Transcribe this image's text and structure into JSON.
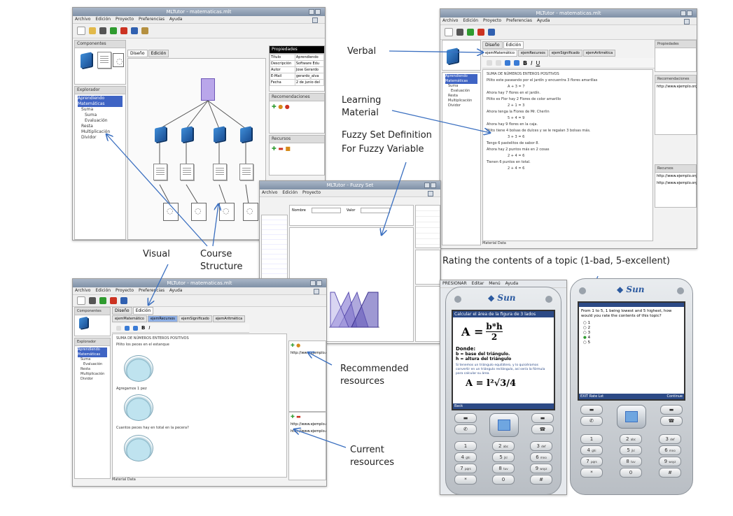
{
  "annotations": {
    "verbal": "Verbal",
    "learning_material": [
      "Learning",
      "Material"
    ],
    "fuzzy_set": [
      "Fuzzy Set Definition",
      "For  Fuzzy Variable"
    ],
    "visual": "Visual",
    "course_structure": [
      "Course",
      "Structure"
    ],
    "rating": "Rating the contents of  a topic (1-bad, 5-excellent)",
    "recommended": [
      "Recommended",
      "resources"
    ],
    "current": [
      "Current",
      "resources"
    ]
  },
  "main_window": {
    "title": "MLTutor - matematicas.mlt",
    "menu": [
      "Archivo",
      "Edición",
      "Proyecto",
      "Preferencias",
      "Ayuda"
    ],
    "components_label": "Componentes",
    "explorer_label": "Explorador",
    "tree": [
      "Aprendiendo Matemáticas",
      "Suma",
      "Suma",
      "Evaluación",
      "Resta",
      "Multiplicación",
      "Dividor"
    ],
    "tabs": [
      "Diseño",
      "Edición"
    ],
    "properties_label": "Propiedades",
    "properties": [
      [
        "Título",
        "Aprendiendo"
      ],
      [
        "Descripción",
        "Software Edu"
      ],
      [
        "Autor",
        "Jose Gerardo"
      ],
      [
        "E-Mail",
        "gerardo_alva"
      ],
      [
        "Fecha",
        "2 de junio del"
      ]
    ],
    "recommendations_label": "Recomendaciones",
    "resources_label": "Recursos"
  },
  "verbal_window": {
    "title": "MLTutor - matematicas.mlt",
    "menu": [
      "Archivo",
      "Edición",
      "Proyecto",
      "Preferencias",
      "Ayuda"
    ],
    "tabs": [
      "Diseño",
      "Edición"
    ],
    "subtabs": [
      "ejemMatemático",
      "ejemRecursos",
      "ejemSignificado",
      "ejemAritmética"
    ],
    "text_lines": [
      "SUMA DE NÚMEROS ENTEROS POSITIVOS",
      "Pilito este paseando por el jardín y encuentra 3 flores amarillas",
      "A + 3 = 7",
      "Ahora hay 7 flores en el jardín.",
      "Pilito es Flor hay 2 Flores de color amarillo",
      "2 + 1 = 3",
      "Ahora tenga la Flores de Mr. Cherlin",
      "5 + 4 = 9",
      "Ahora hay 9 flores en la caja.",
      "Pilito tiene 4 bolsas de dulces y se le regalan 3 bolsas más.",
      "3 + 3 = 6",
      "Tengo 6 pastelitos de sabor 8.",
      "Ahora hay 2 puntos más en 2 cosas",
      "2 + 4 = 6",
      "Tienen 6 puntos en total.",
      "2 + 4 = 6"
    ],
    "status": "Material Data",
    "right_panels": [
      "Propiedades",
      "Recomendaciones",
      "Recursos"
    ],
    "resources": [
      "http://www.ejemplo.org/archivo",
      "http://www.ejemplo.org/ayuda"
    ]
  },
  "fuzzy_window": {
    "title": "MLTutor - Fuzzy Set",
    "inputs": [
      "Nombre",
      "Valor"
    ]
  },
  "visual_window": {
    "title": "MLTutor - matematicas.mlt",
    "menu": [
      "Archivo",
      "Edición",
      "Proyecto",
      "Preferencias",
      "Ayuda"
    ],
    "components_label": "Componentes",
    "explorer_label": "Explorador",
    "tree": [
      "Aprendiendo Matemáticas",
      "Suma",
      "Evaluación",
      "Resta",
      "Multiplicación",
      "Dividor"
    ],
    "tabs": [
      "Diseño",
      "Edición"
    ],
    "subtabs": [
      "ejemMatemático",
      "ejemRecursos",
      "ejemSignificado",
      "ejemAritmética"
    ],
    "text_lines": [
      "SUMA DE NÚMEROS ENTEROS POSITIVOS",
      "Pilito los peces en el estanque",
      "Agregamos 1 pez",
      "Cuantos peces hay en total en la pecera?"
    ],
    "status": "Material Data",
    "resources": [
      "http://www.ejemplo.org/archivo",
      "http://www.ejemplo.org/ayuda"
    ]
  },
  "phone_left": {
    "brand": "Sun",
    "menu": [
      "PRESIONAR",
      "Editar",
      "Menú",
      "Ayuda"
    ],
    "screen_title": "Calcular el área de la figura de 3 lados",
    "formula_1_lhs": "A =",
    "formula_1_num": "b*h",
    "formula_1_den": "2",
    "donde": "Donde:",
    "line_b": "b = base del triángulo.",
    "line_h": "h = altura del triángulo",
    "paragraph": "Si tenemos un triángulo equilátero, y lo quisiéramos convertir en un triángulo rectángulo, así sería la fórmula para calcular su área.",
    "formula_2": "A = l²√3/4",
    "softkey": "Back"
  },
  "phone_right": {
    "brand": "Sun",
    "question": "From 1 to 5, 1 being lowest and 5 highest, how would you rate the contents of this topic?",
    "options": [
      "1",
      "2",
      "3",
      "4",
      "5"
    ],
    "softkeys": [
      "EXIT Rate Lst",
      "Continue"
    ]
  },
  "keypad": [
    [
      "1",
      ""
    ],
    [
      "2",
      "abc"
    ],
    [
      "3",
      "def"
    ],
    [
      "4",
      "ghi"
    ],
    [
      "5",
      "jkl"
    ],
    [
      "6",
      "mno"
    ],
    [
      "7",
      "pqrs"
    ],
    [
      "8",
      "tuv"
    ],
    [
      "9",
      "wxyz"
    ],
    [
      "*",
      "+"
    ],
    [
      "0",
      ""
    ],
    [
      "#",
      "↵"
    ]
  ]
}
